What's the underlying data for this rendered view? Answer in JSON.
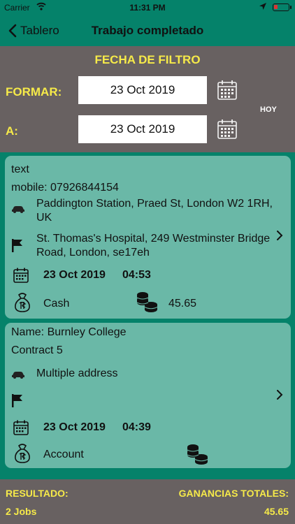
{
  "status_bar": {
    "carrier": "Carrier",
    "time": "11:31 PM"
  },
  "nav": {
    "back_label": "Tablero",
    "title": "Trabajo completado"
  },
  "filter": {
    "title": "FECHA DE FILTRO",
    "from_label": "FORMAR:",
    "from_value": "23 Oct 2019",
    "to_label": "A:",
    "to_value": "23 Oct 2019",
    "today_label": "HOY"
  },
  "jobs": [
    {
      "line1": "text",
      "line2": "mobile:  07926844154",
      "pickup": "Paddington Station, Praed St, London W2 1RH, UK",
      "dropoff": "St. Thomas's Hospital, 249 Westminster Bridge Road, London,  se17eh",
      "date": "23 Oct 2019",
      "time": "04:53",
      "payment": "Cash",
      "amount": "45.65"
    },
    {
      "line1": "Name:  Burnley College",
      "line2": "Contract 5",
      "pickup": "Multiple address",
      "dropoff": "",
      "date": "23 Oct 2019",
      "time": "04:39",
      "payment": "Account",
      "amount": ""
    }
  ],
  "footer": {
    "result_label": "RESULTADO:",
    "result_value": "2 Jobs",
    "earnings_label": "GANANCIAS TOTALES:",
    "earnings_value": "45.65"
  },
  "colors": {
    "header_green": "#05826a",
    "panel_gray": "#686161",
    "accent_yellow": "#f6ea49",
    "card_green": "#6ab8a7"
  }
}
